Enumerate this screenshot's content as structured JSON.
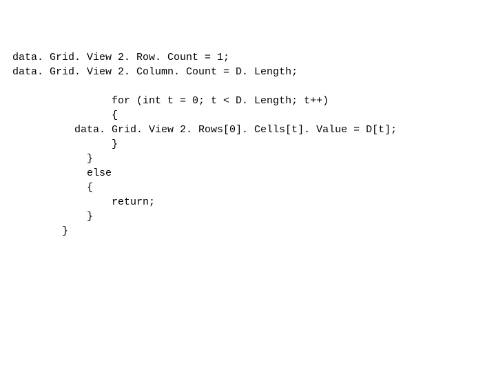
{
  "code": {
    "lines": [
      "data. Grid. View 2. Row. Count = 1;",
      "data. Grid. View 2. Column. Count = D. Length;",
      "",
      "                for (int t = 0; t < D. Length; t++)",
      "                {",
      "          data. Grid. View 2. Rows[0]. Cells[t]. Value = D[t];",
      "                }",
      "            }",
      "            else",
      "            {",
      "                return;",
      "            }",
      "        }"
    ]
  }
}
